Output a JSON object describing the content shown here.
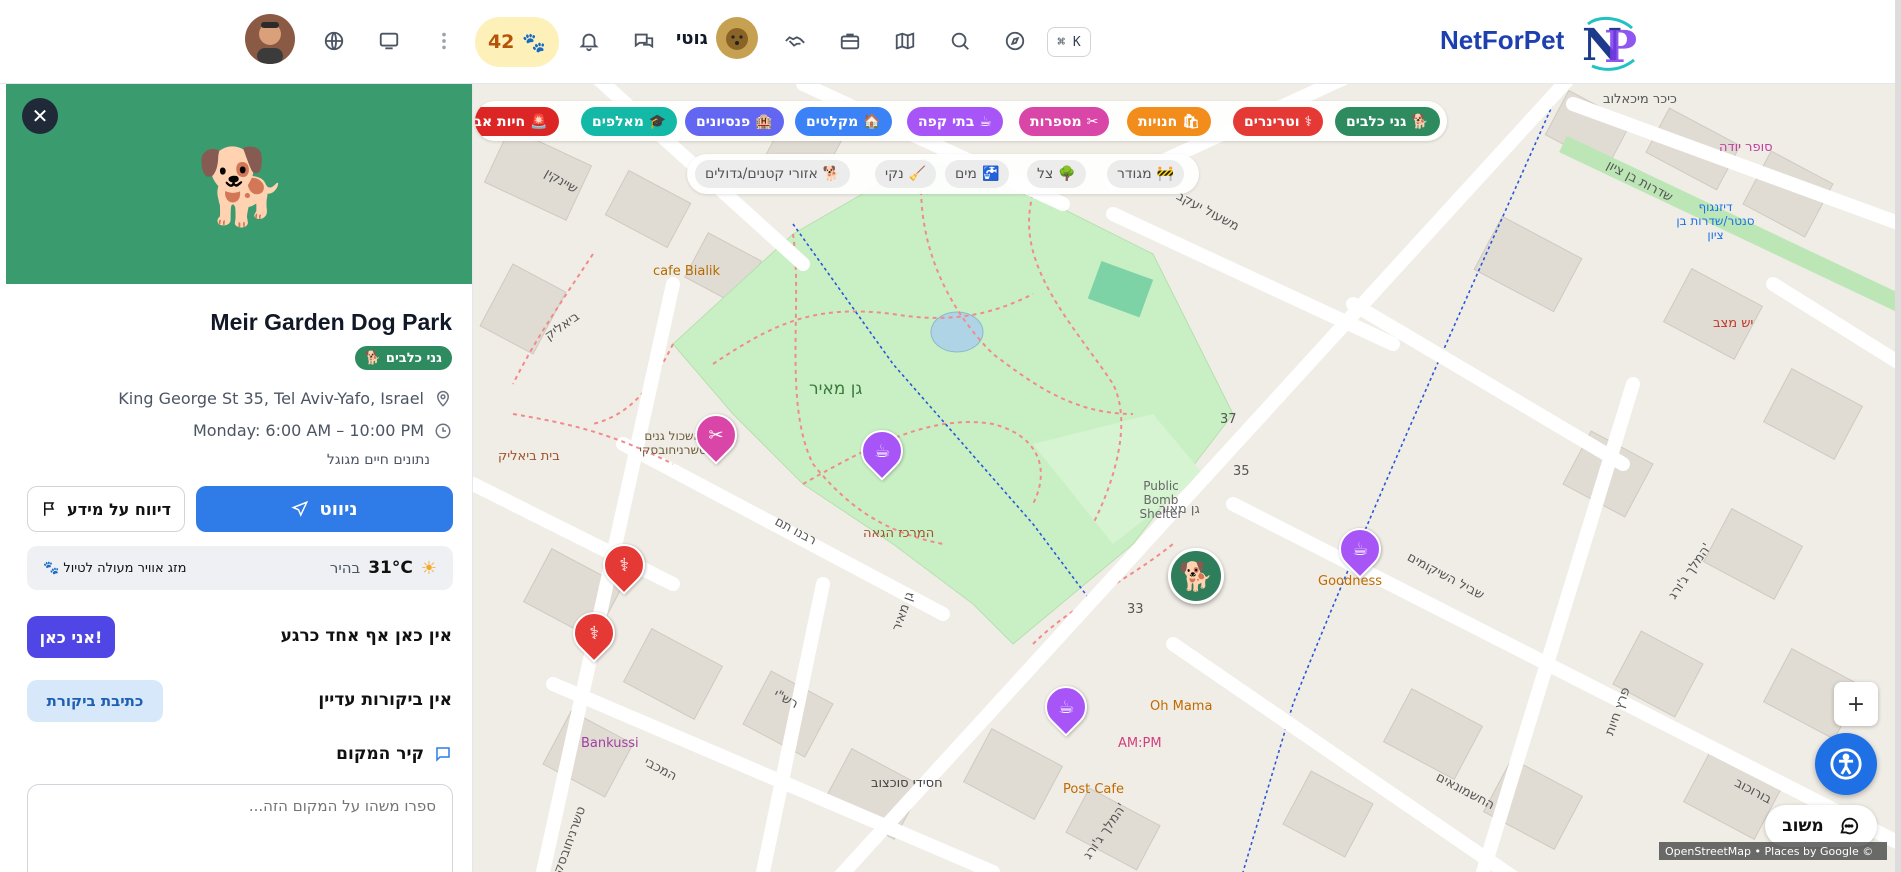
{
  "app": {
    "brand": "NetForPet"
  },
  "topbar": {
    "points": "42",
    "username": "גוטי",
    "kbd_shortcut": "⌘ K",
    "icons": [
      "user-avatar",
      "globe-icon",
      "monitor-icon",
      "more-vertical-icon",
      "bell-icon",
      "messages-icon",
      "handshake-icon",
      "briefcase-icon",
      "map-icon",
      "search-icon",
      "compass-icon"
    ]
  },
  "panel": {
    "title": "Meir Garden Dog Park",
    "category": "גני כלבים",
    "address": "King George St 35, Tel Aviv-Yafo, Israel",
    "hours": "Monday: 6:00 AM – 10:00 PM",
    "note": "נתונים חיים מגוגל",
    "navigate_label": "ניווט",
    "report_label": "דיווח על מידע",
    "weather": {
      "temp": "31°C",
      "condition": "בהיר",
      "note": "מזג אוויר מעולה לטיול"
    },
    "presence_text": "אין כאן אף אחד כרגע",
    "iamhere_label": "אני כאן!",
    "reviews_text": "אין ביקורות עדיין",
    "write_review_label": "כתיבת ביקורת",
    "wall_title": "קיר המקום",
    "wall_placeholder": "ספרו משהו על המקום הזה..."
  },
  "filters": {
    "categories": [
      {
        "label": "גני כלבים",
        "color": "#2e8b5f"
      },
      {
        "label": "וטרינרים",
        "color": "#e53935"
      },
      {
        "label": "חנויות",
        "color": "#f28c1a"
      },
      {
        "label": "מספרות",
        "color": "#d946a8"
      },
      {
        "label": "בתי קפה",
        "color": "#a855f7"
      },
      {
        "label": "מקלטים",
        "color": "#3b82f6"
      },
      {
        "label": "פנסיונים",
        "color": "#6366f1"
      },
      {
        "label": "מאלפים",
        "color": "#14b8a6"
      },
      {
        "label": "חיות אבודות",
        "color": "#dc2626"
      }
    ],
    "amenities": [
      "מגודר",
      "צל",
      "מים",
      "נקי",
      "אזורי קטנים/גדולים"
    ]
  },
  "map": {
    "labels": {
      "park_name": "גן מאיר",
      "park_area": "גן מאיר",
      "shelter": "Public Bomb Shelter",
      "cafe_bialik": "cafe Bialik",
      "beit_bialik": "בית ביאליק",
      "bialik_st": "ביאליק",
      "sheinkin": "שיינקין",
      "king_george": "המלך ג'ורג'",
      "mishol_yaakov": "משעול יעקב",
      "rabbenu_tam": "רבנו תם",
      "gan_meir_st": "גן מאיר",
      "rashi": "רש\"י",
      "hamachbi": "המכבי",
      "tchernichovsky": "טשרניחובסקי",
      "shvil_hashikunim": "שביל השיקומים",
      "hashmonaim": "החשמונאים",
      "burochov": "בורוכוב",
      "frishman": "פרץ חיות",
      "sderot_ben_zion": "שדרות בן ציון",
      "kikar_michaelov": "כיכר מיכאלוב",
      "ashkol": "אשכול גנים טשרניחובסקי",
      "hamerkaz": "המרכז הגאה",
      "goodness": "Goodness",
      "oh_mama": "Oh Mama",
      "ampm": "AM:PM",
      "post_cafe": "Post Cafe",
      "bankussi": "Bankussi",
      "chassidei": "חסידי סוכצוב",
      "super_yuda": "סופר יודה",
      "dizengoff": "דיזנגוף סנטר/שדרות בן ציון",
      "yesh_matzav": "יש מצב",
      "num_35": "35",
      "num_37": "37",
      "num_33": "33"
    },
    "attribution": "OpenStreetMap • Places by Google ©"
  },
  "widgets": {
    "zoom_in": "+",
    "feedback_label": "משוב"
  }
}
